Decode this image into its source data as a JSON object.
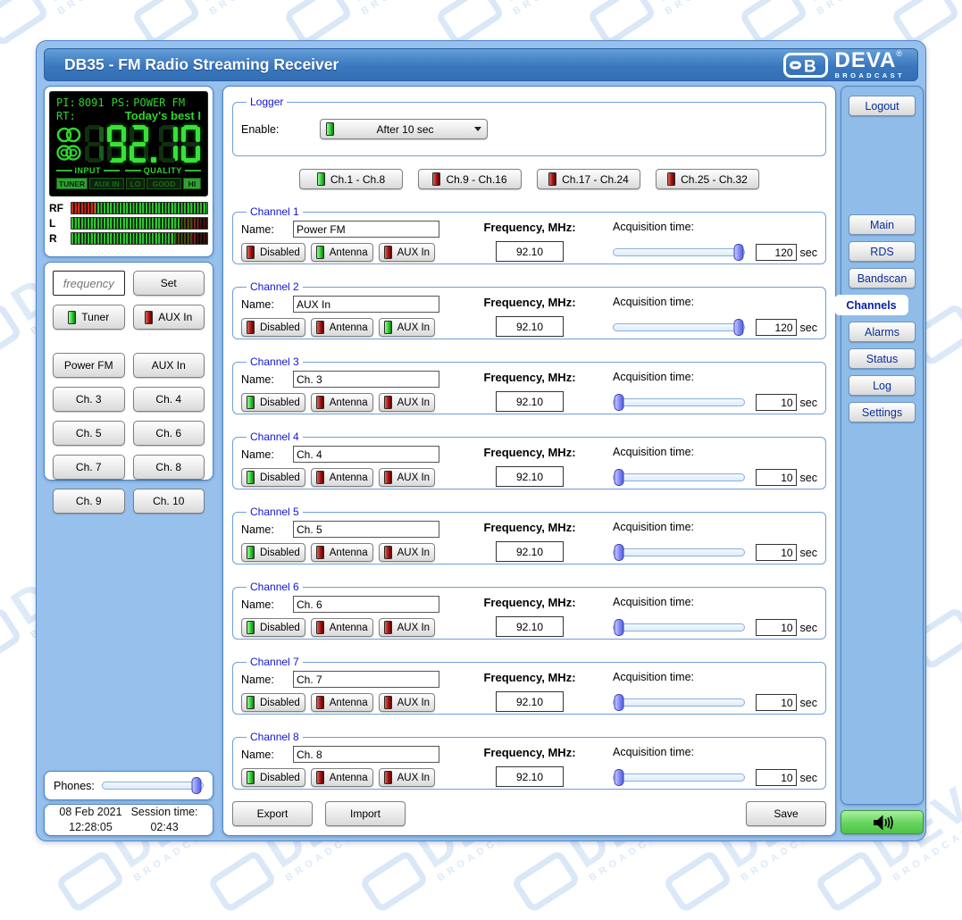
{
  "header": {
    "title": "DB35 - FM Radio Streaming Receiver"
  },
  "logo": {
    "emblem": "DB",
    "name": "DEVA",
    "registered": "®",
    "subtitle": "BROADCAST"
  },
  "lcd": {
    "pi_label": "PI:",
    "pi_value": "8091",
    "ps_label": "PS:",
    "ps_value": "POWER FM",
    "rt_label": "RT:",
    "rt_value": "Today's best I",
    "frequency": "92.10",
    "frequency_dim_prefix": "1",
    "input_group_label": "INPUT",
    "quality_group_label": "QUALITY",
    "indicators": [
      {
        "label": "TUNER",
        "lit": true
      },
      {
        "label": "AUX IN",
        "lit": false
      },
      {
        "label": "LO",
        "lit": false
      },
      {
        "label": "GOOD",
        "lit": false
      },
      {
        "label": "HI",
        "lit": true
      }
    ],
    "lcd_green": "#2fd42f"
  },
  "meters": [
    {
      "label": "RF",
      "zones": [
        {
          "c": "#c92a18",
          "to": 17
        },
        {
          "c": "#2ec22e",
          "to": 100
        }
      ]
    },
    {
      "label": "L",
      "zones": [
        {
          "c": "#2ec22e",
          "to": 80
        },
        {
          "c": "#4a4a12",
          "to": 90
        },
        {
          "c": "#7a241a",
          "to": 94
        },
        {
          "c": "#391410",
          "to": 100
        }
      ]
    },
    {
      "label": "R",
      "zones": [
        {
          "c": "#2ec22e",
          "to": 76
        },
        {
          "c": "#4a4a12",
          "to": 88
        },
        {
          "c": "#7a241a",
          "to": 92
        },
        {
          "c": "#391410",
          "to": 100
        }
      ]
    }
  ],
  "tuner_panel": {
    "frequency_placeholder": "frequency",
    "set_label": "Set",
    "source_buttons": [
      {
        "label": "Tuner",
        "led": "green"
      },
      {
        "label": "AUX In",
        "led": "red"
      }
    ],
    "preset_buttons": [
      "Power FM",
      "AUX In",
      "Ch. 3",
      "Ch. 4",
      "Ch. 5",
      "Ch. 6",
      "Ch. 7",
      "Ch. 8",
      "Ch. 9",
      "Ch. 10"
    ]
  },
  "phones": {
    "label": "Phones:",
    "level_pct": 94
  },
  "clock": {
    "date": "08 Feb 2021",
    "time": "12:28:05",
    "session_label": "Session time:",
    "session_value": "02:43"
  },
  "logger": {
    "legend": "Logger",
    "enable_label": "Enable:",
    "value": "After 10 sec",
    "led": "green"
  },
  "channel_tabs": [
    {
      "label": "Ch.1 - Ch.8",
      "led": "green"
    },
    {
      "label": "Ch.9 - Ch.16",
      "led": "red"
    },
    {
      "label": "Ch.17 - Ch.24",
      "led": "red"
    },
    {
      "label": "Ch.25 - Ch.32",
      "led": "red"
    }
  ],
  "channels": [
    {
      "legend": "Channel 1",
      "name_label": "Name:",
      "name": "Power FM",
      "freq_label": "Frequency, MHz:",
      "frequency": "92.10",
      "acq_label": "Acquisition time:",
      "acq_value": "120",
      "acq_unit": "sec",
      "acq_pct": 96,
      "buttons": [
        {
          "label": "Disabled",
          "led": "red"
        },
        {
          "label": "Antenna",
          "led": "green"
        },
        {
          "label": "AUX In",
          "led": "red"
        }
      ]
    },
    {
      "legend": "Channel 2",
      "name_label": "Name:",
      "name": "AUX In",
      "freq_label": "Frequency, MHz:",
      "frequency": "92.10",
      "acq_label": "Acquisition time:",
      "acq_value": "120",
      "acq_unit": "sec",
      "acq_pct": 96,
      "buttons": [
        {
          "label": "Disabled",
          "led": "red"
        },
        {
          "label": "Antenna",
          "led": "red"
        },
        {
          "label": "AUX In",
          "led": "green"
        }
      ]
    },
    {
      "legend": "Channel 3",
      "name_label": "Name:",
      "name": "Ch. 3",
      "freq_label": "Frequency, MHz:",
      "frequency": "92.10",
      "acq_label": "Acquisition time:",
      "acq_value": "10",
      "acq_unit": "sec",
      "acq_pct": 4,
      "buttons": [
        {
          "label": "Disabled",
          "led": "green"
        },
        {
          "label": "Antenna",
          "led": "red"
        },
        {
          "label": "AUX In",
          "led": "red"
        }
      ]
    },
    {
      "legend": "Channel 4",
      "name_label": "Name:",
      "name": "Ch. 4",
      "freq_label": "Frequency, MHz:",
      "frequency": "92.10",
      "acq_label": "Acquisition time:",
      "acq_value": "10",
      "acq_unit": "sec",
      "acq_pct": 4,
      "buttons": [
        {
          "label": "Disabled",
          "led": "green"
        },
        {
          "label": "Antenna",
          "led": "red"
        },
        {
          "label": "AUX In",
          "led": "red"
        }
      ]
    },
    {
      "legend": "Channel 5",
      "name_label": "Name:",
      "name": "Ch. 5",
      "freq_label": "Frequency, MHz:",
      "frequency": "92.10",
      "acq_label": "Acquisition time:",
      "acq_value": "10",
      "acq_unit": "sec",
      "acq_pct": 4,
      "buttons": [
        {
          "label": "Disabled",
          "led": "green"
        },
        {
          "label": "Antenna",
          "led": "red"
        },
        {
          "label": "AUX In",
          "led": "red"
        }
      ]
    },
    {
      "legend": "Channel 6",
      "name_label": "Name:",
      "name": "Ch. 6",
      "freq_label": "Frequency, MHz:",
      "frequency": "92.10",
      "acq_label": "Acquisition time:",
      "acq_value": "10",
      "acq_unit": "sec",
      "acq_pct": 4,
      "buttons": [
        {
          "label": "Disabled",
          "led": "green"
        },
        {
          "label": "Antenna",
          "led": "red"
        },
        {
          "label": "AUX In",
          "led": "red"
        }
      ]
    },
    {
      "legend": "Channel 7",
      "name_label": "Name:",
      "name": "Ch. 7",
      "freq_label": "Frequency, MHz:",
      "frequency": "92.10",
      "acq_label": "Acquisition time:",
      "acq_value": "10",
      "acq_unit": "sec",
      "acq_pct": 4,
      "buttons": [
        {
          "label": "Disabled",
          "led": "green"
        },
        {
          "label": "Antenna",
          "led": "red"
        },
        {
          "label": "AUX In",
          "led": "red"
        }
      ]
    },
    {
      "legend": "Channel 8",
      "name_label": "Name:",
      "name": "Ch. 8",
      "freq_label": "Frequency, MHz:",
      "frequency": "92.10",
      "acq_label": "Acquisition time:",
      "acq_value": "10",
      "acq_unit": "sec",
      "acq_pct": 4,
      "buttons": [
        {
          "label": "Disabled",
          "led": "green"
        },
        {
          "label": "Antenna",
          "led": "red"
        },
        {
          "label": "AUX In",
          "led": "red"
        }
      ]
    }
  ],
  "footer": {
    "export_label": "Export",
    "import_label": "Import",
    "save_label": "Save"
  },
  "sidebar": {
    "logout_label": "Logout",
    "nav": [
      {
        "label": "Main",
        "active": false
      },
      {
        "label": "RDS",
        "active": false
      },
      {
        "label": "Bandscan",
        "active": false
      },
      {
        "label": "Channels",
        "active": true
      },
      {
        "label": "Alarms",
        "active": false
      },
      {
        "label": "Status",
        "active": false
      },
      {
        "label": "Log",
        "active": false
      },
      {
        "label": "Settings",
        "active": false
      }
    ]
  },
  "colors": {
    "header_blue": "#3a77bd",
    "container_blue": "#97c1ec",
    "border_blue": "#4e87c6",
    "legend_blue": "#1016d0",
    "led_green": "#2ecf2e",
    "led_red": "#a51111",
    "lcd_green": "#2fd42f",
    "speaker_green": "#66d35c",
    "watermark_blue": "#dbe8f8"
  }
}
